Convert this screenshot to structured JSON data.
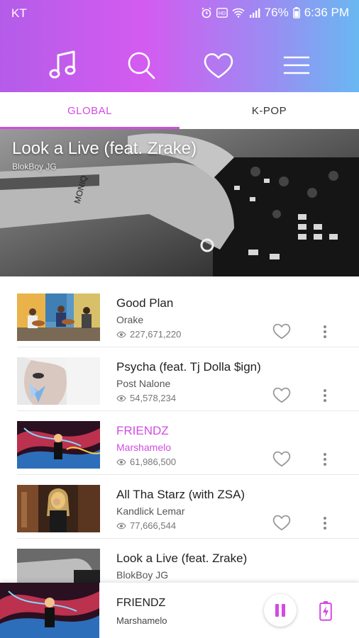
{
  "status": {
    "carrier": "KT",
    "battery": "76%",
    "time": "6:36 PM"
  },
  "nav": {
    "icons": [
      "music-note-icon",
      "search-icon",
      "heart-icon",
      "menu-icon"
    ]
  },
  "tabs": [
    {
      "label": "GLOBAL",
      "selected": true
    },
    {
      "label": "K-POP",
      "selected": false
    }
  ],
  "hero": {
    "title": "Look a Live (feat. Zrake)",
    "artist": "BlokBoy JG"
  },
  "songs": [
    {
      "title": "Good Plan",
      "artist": "Orake",
      "views": "227,671,220"
    },
    {
      "title": "Psycha (feat. Tj Dolla $ign)",
      "artist": "Post Nalone",
      "views": "54,578,234"
    },
    {
      "title": "FRIENDZ",
      "artist": "Marshamelo",
      "views": "61,986,500"
    },
    {
      "title": "All Tha Starz (with ZSA)",
      "artist": "Kandlick Lemar",
      "views": "77,666,544"
    },
    {
      "title": "Look a Live (feat. Zrake)",
      "artist": "BlokBoy JG",
      "views": ""
    }
  ],
  "player": {
    "title": "FRIENDZ",
    "artist": "Marshamelo"
  },
  "colors": {
    "accent": "#d34be3",
    "header_start": "#b45ce9",
    "header_end": "#69b8f2"
  }
}
